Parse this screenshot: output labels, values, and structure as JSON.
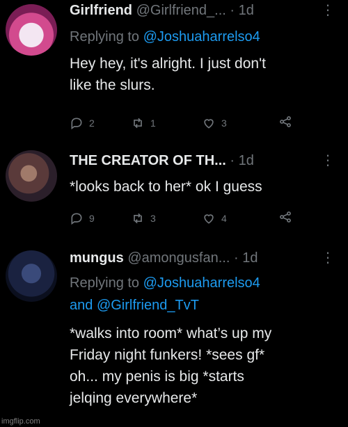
{
  "tweets": [
    {
      "name": "Girlfriend",
      "handle": "@Girlfriend_...",
      "dot": "·",
      "time": "1d",
      "more": "⋮",
      "replying_prefix": "Replying to",
      "replying_to": "@Joshuaharrelso4",
      "body_lines": [
        "Hey hey, it's alright. I just don't",
        "like the slurs."
      ],
      "replies": "2",
      "retweets": "1",
      "likes": "3"
    },
    {
      "name": "THE CREATOR OF TH...",
      "dot": "·",
      "time": "1d",
      "more": "⋮",
      "body_lines": [
        "*looks back to her* ok I guess"
      ],
      "replies": "9",
      "retweets": "3",
      "likes": "4"
    },
    {
      "name": "mungus",
      "handle": "@amongusfan...",
      "dot": "·",
      "time": "1d",
      "more": "⋮",
      "replying_prefix": "Replying to",
      "replying_to": "@Joshuaharrelso4",
      "replying_and": "and",
      "replying_to_2": "@Girlfriend_TvT",
      "body_lines": [
        "*walks into room* what’s up my",
        "Friday night funkers! *sees gf*",
        "oh... my penis is big *starts",
        "jelqing everywhere*"
      ]
    }
  ],
  "watermark": "imgflip.com",
  "colors": {
    "background": "#000000",
    "text": "#e7e9ea",
    "muted": "#71767b",
    "link": "#1d9bf0"
  },
  "icons": [
    "reply-icon",
    "retweet-icon",
    "like-icon",
    "share-icon",
    "more-icon"
  ]
}
